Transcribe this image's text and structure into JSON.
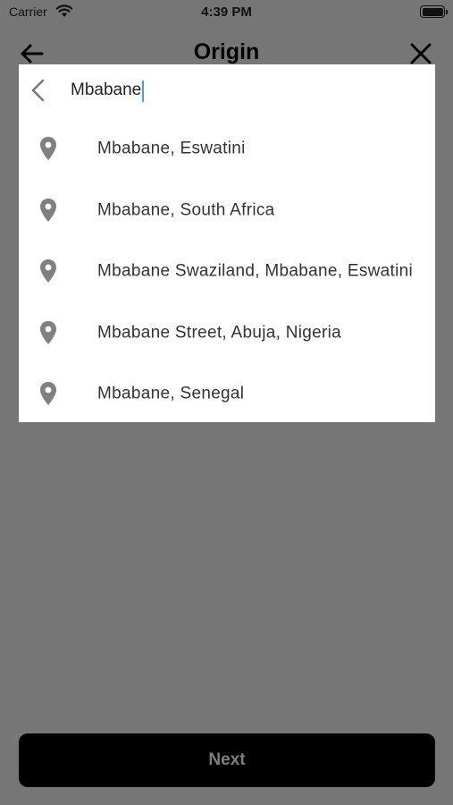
{
  "status_bar": {
    "carrier": "Carrier",
    "time": "4:39 PM",
    "wifi_icon": "wifi-icon",
    "battery_icon": "battery-icon"
  },
  "nav": {
    "title": "Origin",
    "back_icon": "arrow-left-icon",
    "close_icon": "close-icon"
  },
  "search": {
    "value": "Mbabane",
    "back_icon": "chevron-left-icon"
  },
  "results": [
    {
      "label": "Mbabane, Eswatini",
      "icon": "location-pin-icon"
    },
    {
      "label": "Mbabane, South Africa",
      "icon": "location-pin-icon"
    },
    {
      "label": "Mbabane Swaziland, Mbabane, Eswatini",
      "icon": "location-pin-icon"
    },
    {
      "label": "Mbabane Street, Abuja, Nigeria",
      "icon": "location-pin-icon"
    },
    {
      "label": "Mbabane, Senegal",
      "icon": "location-pin-icon"
    }
  ],
  "footer": {
    "next_label": "Next"
  },
  "colors": {
    "backdrop": "#767676",
    "panel": "#ffffff",
    "pin": "#808080",
    "caret": "#4a9ee8",
    "button_bg": "#000000",
    "button_text": "#7e7e7e"
  }
}
